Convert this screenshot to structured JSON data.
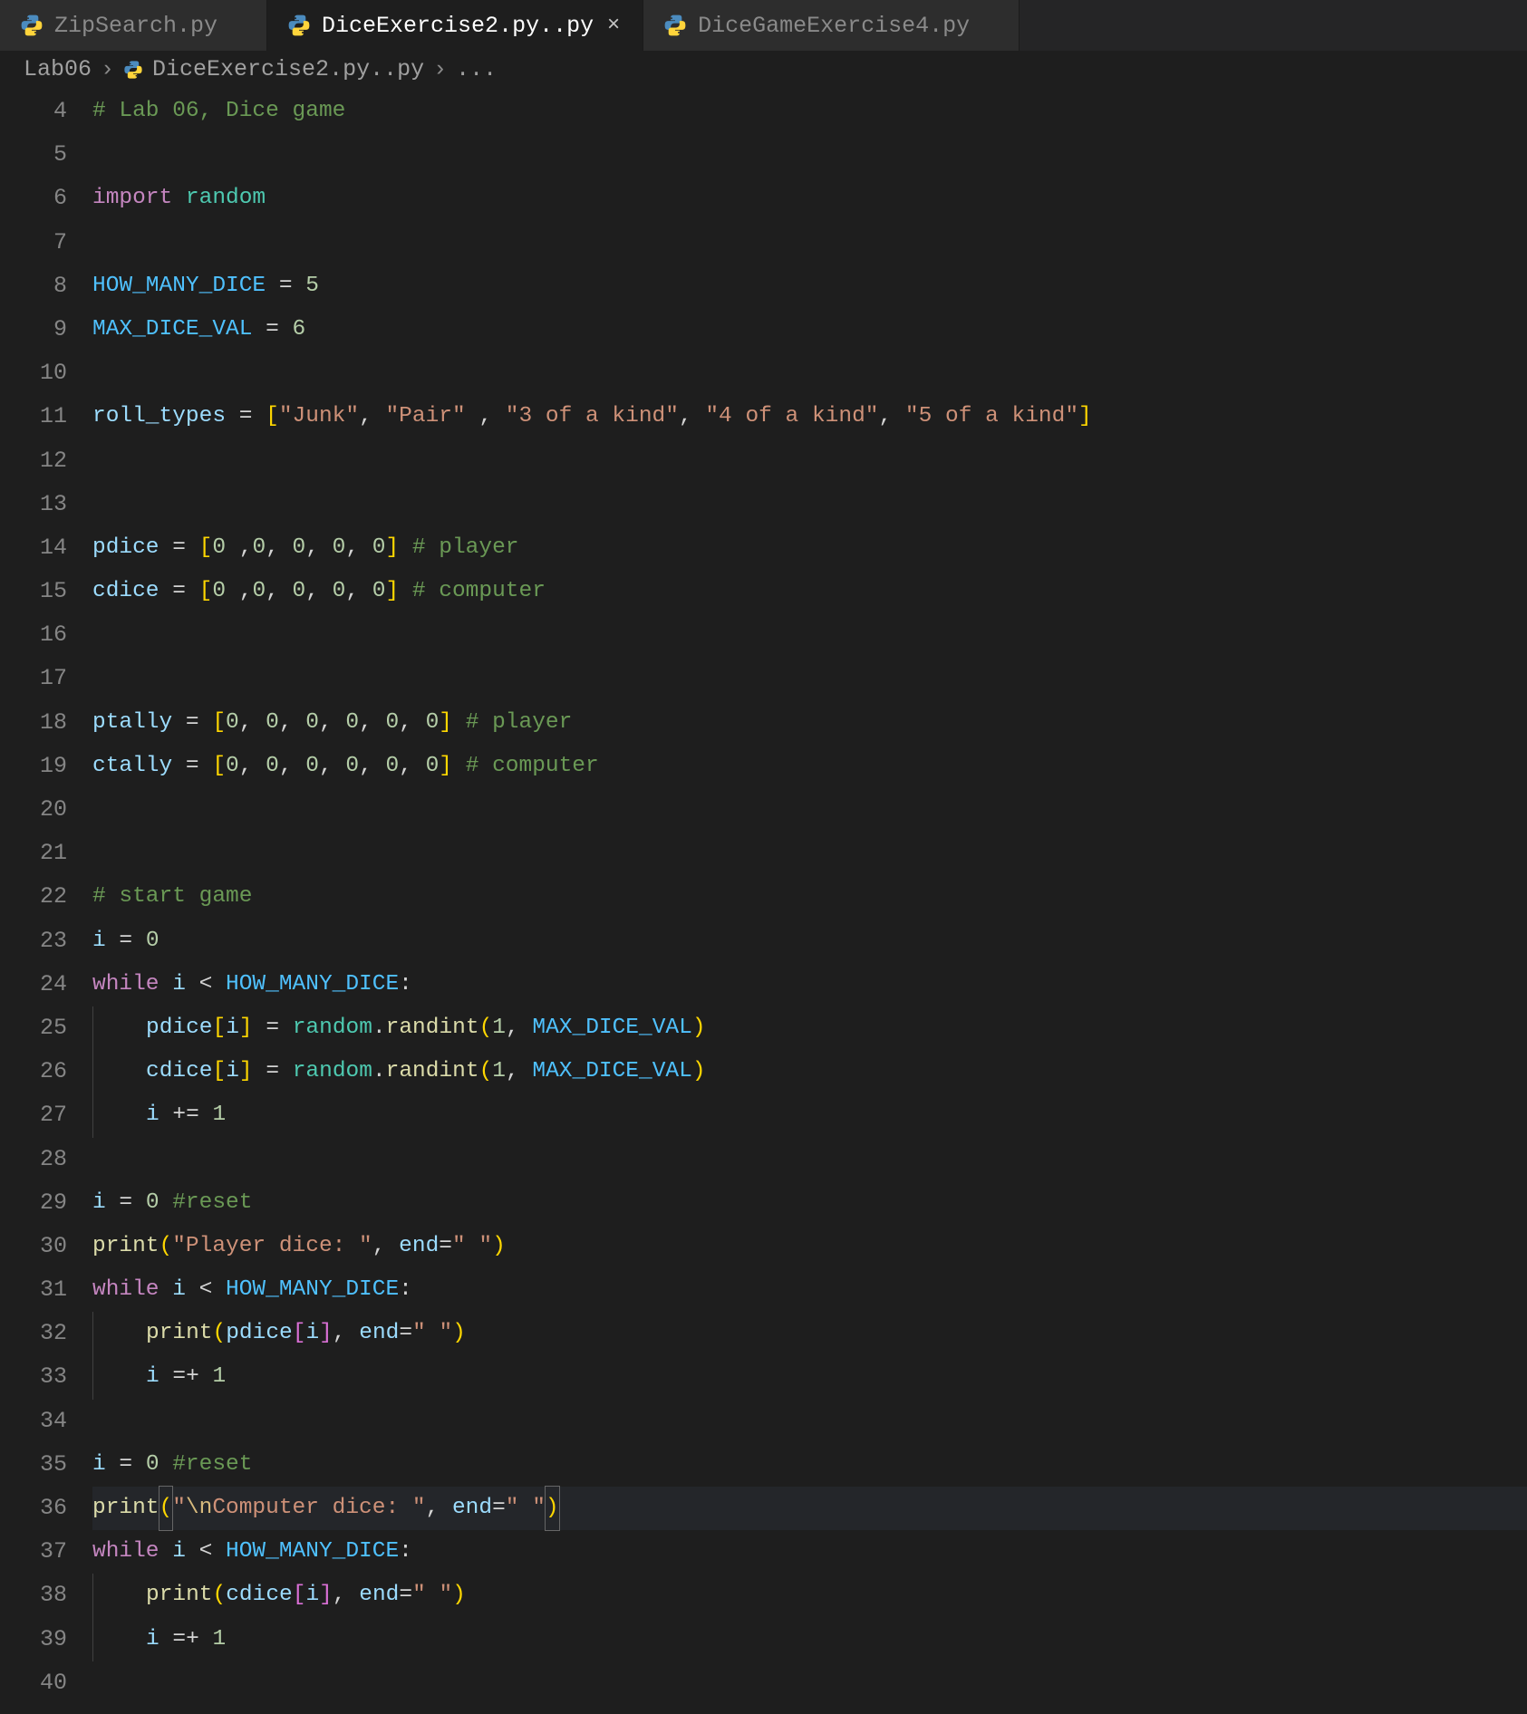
{
  "tabs": [
    {
      "label": "ZipSearch.py",
      "active": false
    },
    {
      "label": "DiceExercise2.py..py",
      "active": true
    },
    {
      "label": "DiceGameExercise4.py",
      "active": false
    }
  ],
  "breadcrumbs": {
    "folder": "Lab06",
    "file": "DiceExercise2.py..py",
    "trail": "..."
  },
  "firstLine": 4,
  "lines": [
    [
      {
        "t": "# Lab 06, Dice game",
        "c": "c-comment"
      }
    ],
    [],
    [
      {
        "t": "import",
        "c": "c-keyword"
      },
      {
        "t": " "
      },
      {
        "t": "random",
        "c": "c-module"
      }
    ],
    [],
    [
      {
        "t": "HOW_MANY_DICE",
        "c": "c-const"
      },
      {
        "t": " = "
      },
      {
        "t": "5",
        "c": "c-num"
      }
    ],
    [
      {
        "t": "MAX_DICE_VAL",
        "c": "c-const"
      },
      {
        "t": " = "
      },
      {
        "t": "6",
        "c": "c-num"
      }
    ],
    [],
    [
      {
        "t": "roll_types",
        "c": "c-var"
      },
      {
        "t": " = "
      },
      {
        "t": "[",
        "c": "c-brk-y"
      },
      {
        "t": "\"Junk\"",
        "c": "c-str"
      },
      {
        "t": ", "
      },
      {
        "t": "\"Pair\"",
        "c": "c-str"
      },
      {
        "t": " , "
      },
      {
        "t": "\"3 of a kind\"",
        "c": "c-str"
      },
      {
        "t": ", "
      },
      {
        "t": "\"4 of a kind\"",
        "c": "c-str"
      },
      {
        "t": ", "
      },
      {
        "t": "\"5 of a kind\"",
        "c": "c-str"
      },
      {
        "t": "]",
        "c": "c-brk-y"
      }
    ],
    [],
    [],
    [
      {
        "t": "pdice",
        "c": "c-var"
      },
      {
        "t": " = "
      },
      {
        "t": "[",
        "c": "c-brk-y"
      },
      {
        "t": "0",
        "c": "c-num"
      },
      {
        "t": " ,"
      },
      {
        "t": "0",
        "c": "c-num"
      },
      {
        "t": ", "
      },
      {
        "t": "0",
        "c": "c-num"
      },
      {
        "t": ", "
      },
      {
        "t": "0",
        "c": "c-num"
      },
      {
        "t": ", "
      },
      {
        "t": "0",
        "c": "c-num"
      },
      {
        "t": "]",
        "c": "c-brk-y"
      },
      {
        "t": " "
      },
      {
        "t": "# player",
        "c": "c-comment"
      }
    ],
    [
      {
        "t": "cdice",
        "c": "c-var"
      },
      {
        "t": " = "
      },
      {
        "t": "[",
        "c": "c-brk-y"
      },
      {
        "t": "0",
        "c": "c-num"
      },
      {
        "t": " ,"
      },
      {
        "t": "0",
        "c": "c-num"
      },
      {
        "t": ", "
      },
      {
        "t": "0",
        "c": "c-num"
      },
      {
        "t": ", "
      },
      {
        "t": "0",
        "c": "c-num"
      },
      {
        "t": ", "
      },
      {
        "t": "0",
        "c": "c-num"
      },
      {
        "t": "]",
        "c": "c-brk-y"
      },
      {
        "t": " "
      },
      {
        "t": "# computer",
        "c": "c-comment"
      }
    ],
    [],
    [],
    [
      {
        "t": "ptally",
        "c": "c-var"
      },
      {
        "t": " = "
      },
      {
        "t": "[",
        "c": "c-brk-y"
      },
      {
        "t": "0",
        "c": "c-num"
      },
      {
        "t": ", "
      },
      {
        "t": "0",
        "c": "c-num"
      },
      {
        "t": ", "
      },
      {
        "t": "0",
        "c": "c-num"
      },
      {
        "t": ", "
      },
      {
        "t": "0",
        "c": "c-num"
      },
      {
        "t": ", "
      },
      {
        "t": "0",
        "c": "c-num"
      },
      {
        "t": ", "
      },
      {
        "t": "0",
        "c": "c-num"
      },
      {
        "t": "]",
        "c": "c-brk-y"
      },
      {
        "t": " "
      },
      {
        "t": "# player",
        "c": "c-comment"
      }
    ],
    [
      {
        "t": "ctally",
        "c": "c-var"
      },
      {
        "t": " = "
      },
      {
        "t": "[",
        "c": "c-brk-y"
      },
      {
        "t": "0",
        "c": "c-num"
      },
      {
        "t": ", "
      },
      {
        "t": "0",
        "c": "c-num"
      },
      {
        "t": ", "
      },
      {
        "t": "0",
        "c": "c-num"
      },
      {
        "t": ", "
      },
      {
        "t": "0",
        "c": "c-num"
      },
      {
        "t": ", "
      },
      {
        "t": "0",
        "c": "c-num"
      },
      {
        "t": ", "
      },
      {
        "t": "0",
        "c": "c-num"
      },
      {
        "t": "]",
        "c": "c-brk-y"
      },
      {
        "t": " "
      },
      {
        "t": "# computer",
        "c": "c-comment"
      }
    ],
    [],
    [],
    [
      {
        "t": "# start game",
        "c": "c-comment"
      }
    ],
    [
      {
        "t": "i",
        "c": "c-var"
      },
      {
        "t": " = "
      },
      {
        "t": "0",
        "c": "c-num"
      }
    ],
    [
      {
        "t": "while",
        "c": "c-keyword"
      },
      {
        "t": " "
      },
      {
        "t": "i",
        "c": "c-var"
      },
      {
        "t": " < "
      },
      {
        "t": "HOW_MANY_DICE",
        "c": "c-const"
      },
      {
        "t": ":"
      }
    ],
    [
      {
        "indent": 1,
        "guide": true
      },
      {
        "t": "pdice",
        "c": "c-var"
      },
      {
        "t": "[",
        "c": "c-brk-y"
      },
      {
        "t": "i",
        "c": "c-var"
      },
      {
        "t": "]",
        "c": "c-brk-y"
      },
      {
        "t": " = "
      },
      {
        "t": "random",
        "c": "c-module"
      },
      {
        "t": "."
      },
      {
        "t": "randint",
        "c": "c-func"
      },
      {
        "t": "(",
        "c": "c-brk-y"
      },
      {
        "t": "1",
        "c": "c-num"
      },
      {
        "t": ", "
      },
      {
        "t": "MAX_DICE_VAL",
        "c": "c-const"
      },
      {
        "t": ")",
        "c": "c-brk-y"
      }
    ],
    [
      {
        "indent": 1,
        "guide": true
      },
      {
        "t": "cdice",
        "c": "c-var"
      },
      {
        "t": "[",
        "c": "c-brk-y"
      },
      {
        "t": "i",
        "c": "c-var"
      },
      {
        "t": "]",
        "c": "c-brk-y"
      },
      {
        "t": " = "
      },
      {
        "t": "random",
        "c": "c-module"
      },
      {
        "t": "."
      },
      {
        "t": "randint",
        "c": "c-func"
      },
      {
        "t": "(",
        "c": "c-brk-y"
      },
      {
        "t": "1",
        "c": "c-num"
      },
      {
        "t": ", "
      },
      {
        "t": "MAX_DICE_VAL",
        "c": "c-const"
      },
      {
        "t": ")",
        "c": "c-brk-y"
      }
    ],
    [
      {
        "indent": 1,
        "guide": true
      },
      {
        "t": "i",
        "c": "c-var"
      },
      {
        "t": " += "
      },
      {
        "t": "1",
        "c": "c-num"
      }
    ],
    [],
    [
      {
        "t": "i",
        "c": "c-var"
      },
      {
        "t": " = "
      },
      {
        "t": "0",
        "c": "c-num"
      },
      {
        "t": " "
      },
      {
        "t": "#reset",
        "c": "c-comment"
      }
    ],
    [
      {
        "t": "print",
        "c": "c-func"
      },
      {
        "t": "(",
        "c": "c-brk-y"
      },
      {
        "t": "\"Player dice: \"",
        "c": "c-str"
      },
      {
        "t": ", "
      },
      {
        "t": "end",
        "c": "c-var"
      },
      {
        "t": "="
      },
      {
        "t": "\" \"",
        "c": "c-str"
      },
      {
        "t": ")",
        "c": "c-brk-y"
      }
    ],
    [
      {
        "t": "while",
        "c": "c-keyword"
      },
      {
        "t": " "
      },
      {
        "t": "i",
        "c": "c-var"
      },
      {
        "t": " < "
      },
      {
        "t": "HOW_MANY_DICE",
        "c": "c-const"
      },
      {
        "t": ":"
      }
    ],
    [
      {
        "indent": 1,
        "guide": true
      },
      {
        "t": "print",
        "c": "c-func"
      },
      {
        "t": "(",
        "c": "c-brk-y"
      },
      {
        "t": "pdice",
        "c": "c-var"
      },
      {
        "t": "[",
        "c": "c-brk-p"
      },
      {
        "t": "i",
        "c": "c-var"
      },
      {
        "t": "]",
        "c": "c-brk-p"
      },
      {
        "t": ", "
      },
      {
        "t": "end",
        "c": "c-var"
      },
      {
        "t": "="
      },
      {
        "t": "\" \"",
        "c": "c-str"
      },
      {
        "t": ")",
        "c": "c-brk-y"
      }
    ],
    [
      {
        "indent": 1,
        "guide": true
      },
      {
        "t": "i",
        "c": "c-var"
      },
      {
        "t": " =+ "
      },
      {
        "t": "1",
        "c": "c-num"
      }
    ],
    [],
    [
      {
        "t": "i",
        "c": "c-var"
      },
      {
        "t": " = "
      },
      {
        "t": "0",
        "c": "c-num"
      },
      {
        "t": " "
      },
      {
        "t": "#reset",
        "c": "c-comment"
      }
    ],
    [
      {
        "hl": true
      },
      {
        "t": "print",
        "c": "c-func"
      },
      {
        "t": "(",
        "c": "c-brk-y",
        "box": true
      },
      {
        "t": "\"",
        "c": "c-str"
      },
      {
        "t": "\\n",
        "c": "c-esc"
      },
      {
        "t": "Computer dice: \"",
        "c": "c-str"
      },
      {
        "t": ", "
      },
      {
        "t": "end",
        "c": "c-var"
      },
      {
        "t": "="
      },
      {
        "t": "\" \"",
        "c": "c-str"
      },
      {
        "t": ")",
        "c": "c-brk-y",
        "box": true
      }
    ],
    [
      {
        "t": "while",
        "c": "c-keyword"
      },
      {
        "t": " "
      },
      {
        "t": "i",
        "c": "c-var"
      },
      {
        "t": " < "
      },
      {
        "t": "HOW_MANY_DICE",
        "c": "c-const"
      },
      {
        "t": ":"
      }
    ],
    [
      {
        "indent": 1,
        "guide": true
      },
      {
        "t": "print",
        "c": "c-func"
      },
      {
        "t": "(",
        "c": "c-brk-y"
      },
      {
        "t": "cdice",
        "c": "c-var"
      },
      {
        "t": "[",
        "c": "c-brk-p"
      },
      {
        "t": "i",
        "c": "c-var"
      },
      {
        "t": "]",
        "c": "c-brk-p"
      },
      {
        "t": ", "
      },
      {
        "t": "end",
        "c": "c-var"
      },
      {
        "t": "="
      },
      {
        "t": "\" \"",
        "c": "c-str"
      },
      {
        "t": ")",
        "c": "c-brk-y"
      }
    ],
    [
      {
        "indent": 1,
        "guide": true
      },
      {
        "t": "i",
        "c": "c-var"
      },
      {
        "t": " =+ "
      },
      {
        "t": "1",
        "c": "c-num"
      }
    ],
    []
  ]
}
